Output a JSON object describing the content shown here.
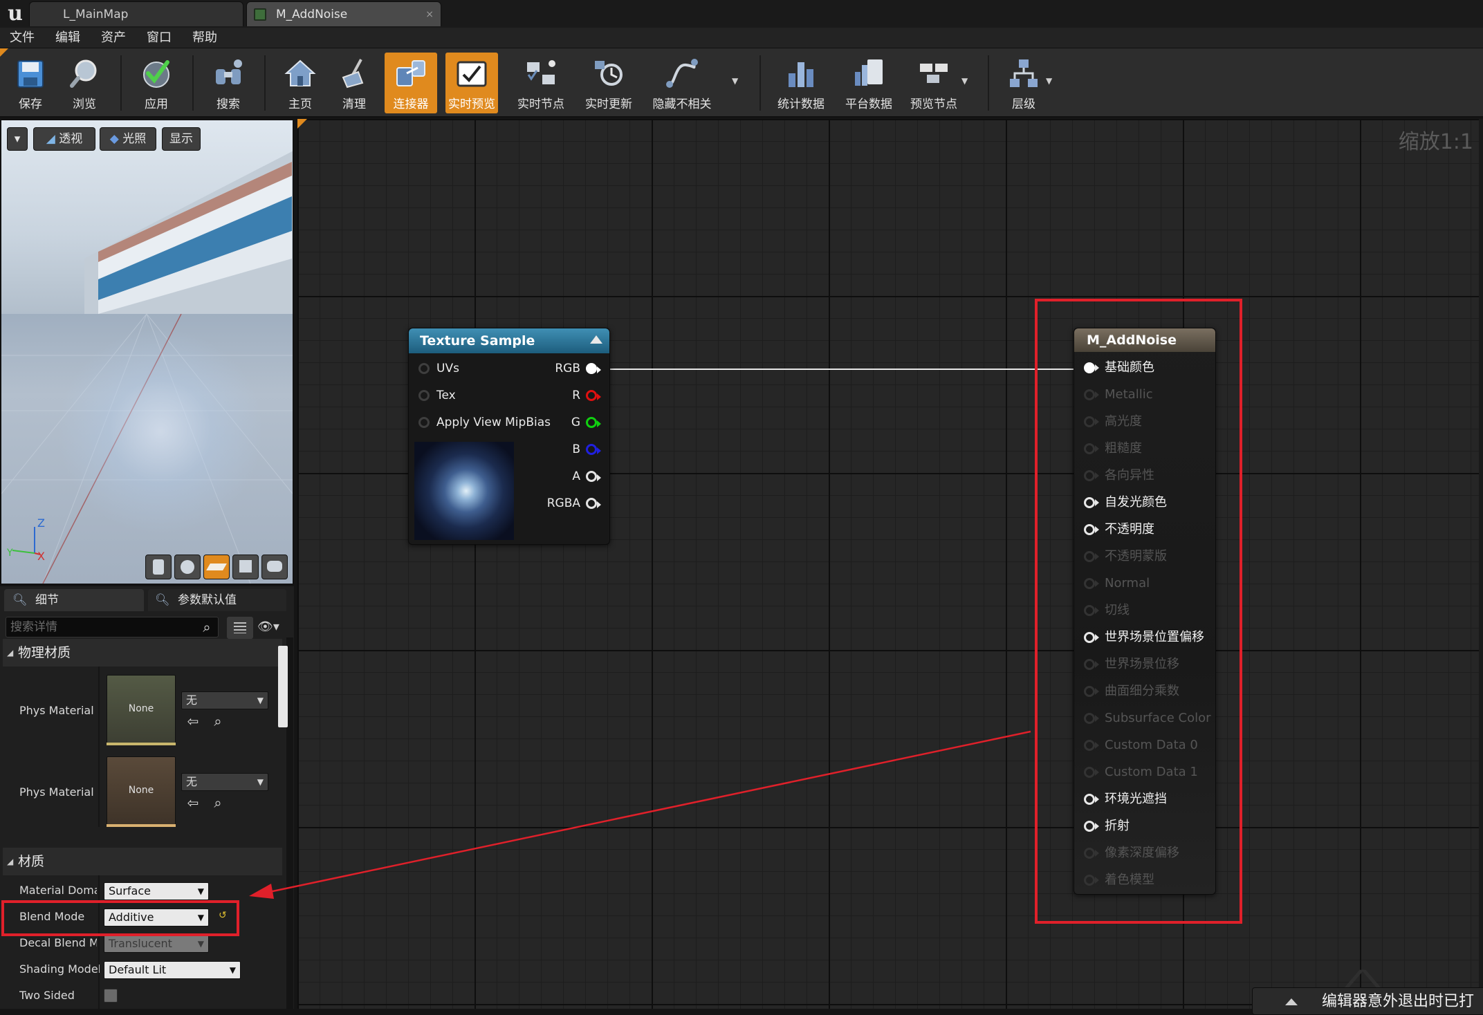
{
  "tabs": {
    "map": "L_MainMap",
    "material": "M_AddNoise",
    "close": "×"
  },
  "menu": [
    "文件",
    "编辑",
    "资产",
    "窗口",
    "帮助"
  ],
  "toolbar": [
    {
      "label": "保存",
      "icon": "save-icon",
      "active": false
    },
    {
      "label": "浏览",
      "icon": "browse-icon",
      "active": false
    },
    {
      "label": "应用",
      "icon": "apply-icon",
      "active": false
    },
    {
      "label": "搜索",
      "icon": "search-icon",
      "active": false
    },
    {
      "label": "主页",
      "icon": "home-icon",
      "active": false
    },
    {
      "label": "清理",
      "icon": "clean-icon",
      "active": false
    },
    {
      "label": "连接器",
      "icon": "connectors-icon",
      "active": true
    },
    {
      "label": "实时预览",
      "icon": "live-preview-icon",
      "active": true
    },
    {
      "label": "实时节点",
      "icon": "live-nodes-icon",
      "active": false
    },
    {
      "label": "实时更新",
      "icon": "live-update-icon",
      "active": false
    },
    {
      "label": "隐藏不相关",
      "icon": "hide-unrelated-icon",
      "active": false
    },
    {
      "label": "统计数据",
      "icon": "stats-icon",
      "active": false
    },
    {
      "label": "平台数据",
      "icon": "platform-stats-icon",
      "active": false
    },
    {
      "label": "预览节点",
      "icon": "preview-node-icon",
      "active": false
    },
    {
      "label": "层级",
      "icon": "hierarchy-icon",
      "active": false
    }
  ],
  "viewport": {
    "buttons": {
      "perspective": "透视",
      "lit": "光照",
      "show": "显示"
    },
    "axis": {
      "z": "Z",
      "x": "X",
      "y": "Y"
    }
  },
  "details": {
    "tabs": {
      "details": "细节",
      "params": "参数默认值"
    },
    "search_placeholder": "搜索详情",
    "section_phys": "物理材质",
    "phys_material_label": "Phys Material",
    "phys_material_map_label": "Phys Material Mask",
    "none_thumb": "None",
    "none_combo": "无",
    "section_material": "材质",
    "rows": [
      {
        "label": "Material Domain",
        "value": "Surface"
      },
      {
        "label": "Blend Mode",
        "value": "Additive"
      },
      {
        "label": "Decal Blend Mode",
        "value": "Translucent"
      },
      {
        "label": "Shading Model",
        "value": "Default Lit"
      },
      {
        "label": "Two Sided",
        "value": ""
      }
    ]
  },
  "graph": {
    "zoom": "缩放1:1",
    "texture_node": {
      "title": "Texture Sample",
      "inputs": [
        "UVs",
        "Tex",
        "Apply View MipBias"
      ],
      "outputs": [
        {
          "label": "RGB",
          "color": "#ffffff"
        },
        {
          "label": "R",
          "color": "#e01010"
        },
        {
          "label": "G",
          "color": "#10d010"
        },
        {
          "label": "B",
          "color": "#2020e0"
        },
        {
          "label": "A",
          "color": "#e8e8e8"
        },
        {
          "label": "RGBA",
          "color": "#e8e8e8"
        }
      ]
    },
    "material_node": {
      "title": "M_AddNoise",
      "pins": [
        {
          "label": "基础颜色",
          "active": true,
          "connected": true
        },
        {
          "label": "Metallic",
          "active": false
        },
        {
          "label": "高光度",
          "active": false
        },
        {
          "label": "粗糙度",
          "active": false
        },
        {
          "label": "各向异性",
          "active": false
        },
        {
          "label": "自发光颜色",
          "active": true
        },
        {
          "label": "不透明度",
          "active": true
        },
        {
          "label": "不透明蒙版",
          "active": false
        },
        {
          "label": "Normal",
          "active": false
        },
        {
          "label": "切线",
          "active": false
        },
        {
          "label": "世界场景位置偏移",
          "active": true
        },
        {
          "label": "世界场景位移",
          "active": false
        },
        {
          "label": "曲面细分乘数",
          "active": false
        },
        {
          "label": "Subsurface Color",
          "active": false
        },
        {
          "label": "Custom Data 0",
          "active": false
        },
        {
          "label": "Custom Data 1",
          "active": false
        },
        {
          "label": "环境光遮挡",
          "active": true
        },
        {
          "label": "折射",
          "active": true
        },
        {
          "label": "像素深度偏移",
          "active": false
        },
        {
          "label": "着色模型",
          "active": false
        }
      ]
    }
  },
  "toast": "编辑器意外退出时已打",
  "colors": {
    "accent": "#e08a1e",
    "annotation": "#e0202a"
  }
}
